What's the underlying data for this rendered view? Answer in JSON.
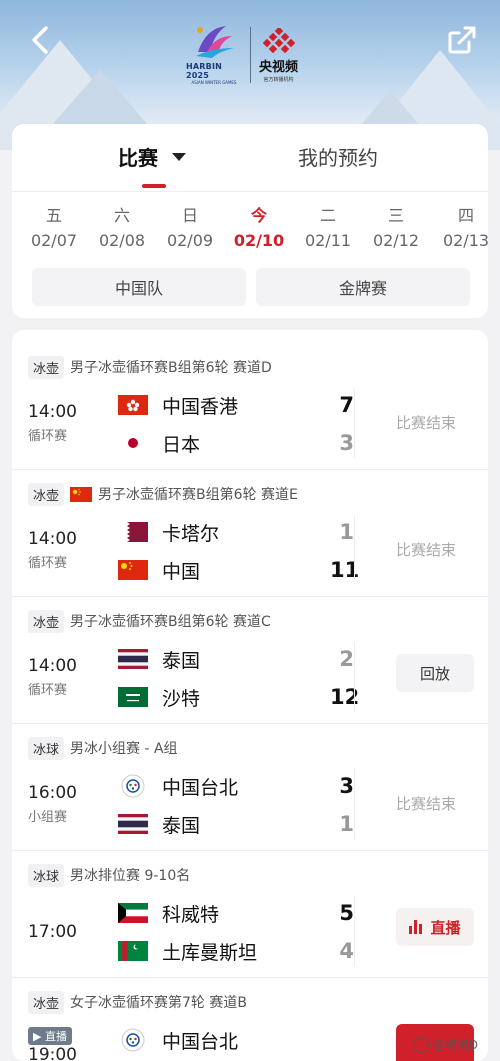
{
  "header": {
    "harbin_logo_text": "HARBIN 2025",
    "harbin_logo_sub": "ASIAN WINTER GAMES",
    "cctv_name": "央视频",
    "cctv_sub": "官方转播机构"
  },
  "main_tabs": [
    {
      "label": "比赛",
      "active": true
    },
    {
      "label": "我的预约",
      "active": false
    }
  ],
  "dates": [
    {
      "weekday": "五",
      "date": "02/07"
    },
    {
      "weekday": "六",
      "date": "02/08"
    },
    {
      "weekday": "日",
      "date": "02/09"
    },
    {
      "weekday": "今",
      "date": "02/10",
      "active": true
    },
    {
      "weekday": "二",
      "date": "02/11"
    },
    {
      "weekday": "三",
      "date": "02/12"
    },
    {
      "weekday": "四",
      "date": "02/13"
    }
  ],
  "filters": [
    "中国队",
    "金牌赛"
  ],
  "matches": [
    {
      "sport": "冰壶",
      "event": "男子冰壶循环赛B组第6轮 赛道D",
      "time": "14:00",
      "stage": "循环赛",
      "team1": {
        "name": "中国香港",
        "score": "7",
        "flag": "hk-flag-icon"
      },
      "team2": {
        "name": "日本",
        "score": "3",
        "flag": "japan-flag-icon"
      },
      "status": "比赛结束"
    },
    {
      "sport": "冰壶",
      "event": "男子冰壶循环赛B组第6轮 赛道E",
      "time": "14:00",
      "stage": "循环赛",
      "team1": {
        "name": "卡塔尔",
        "score": "1",
        "flag": "qatar-flag-icon"
      },
      "team2": {
        "name": "中国",
        "score": "11",
        "flag": "china-flag-icon"
      },
      "status": "比赛结束"
    },
    {
      "sport": "冰壶",
      "event": "男子冰壶循环赛B组第6轮 赛道C",
      "time": "14:00",
      "stage": "循环赛",
      "team1": {
        "name": "泰国",
        "score": "2",
        "flag": "thailand-flag-icon"
      },
      "team2": {
        "name": "沙特",
        "score": "12",
        "flag": "saudi-flag-icon"
      },
      "status": "回放"
    },
    {
      "sport": "冰球",
      "event": "男冰小组赛 - A组",
      "time": "16:00",
      "stage": "小组赛",
      "team1": {
        "name": "中国台北",
        "score": "3",
        "flag": "chinese-taipei-flag-icon"
      },
      "team2": {
        "name": "泰国",
        "score": "1",
        "flag": "thailand-flag-icon"
      },
      "status": "比赛结束"
    },
    {
      "sport": "冰球",
      "event": "男冰排位赛 9-10名",
      "time": "17:00",
      "stage": "",
      "team1": {
        "name": "科威特",
        "score": "5",
        "flag": "kuwait-flag-icon"
      },
      "team2": {
        "name": "土库曼斯坦",
        "score": "4",
        "flag": "turkmenistan-flag-icon"
      },
      "status": "直播"
    },
    {
      "sport": "冰壶",
      "event": "女子冰壶循环赛第7轮 赛道B",
      "time": "19:00",
      "stage": "",
      "live_tag": "直播",
      "team1": {
        "name": "中国台北",
        "score": "",
        "flag": "chinese-taipei-flag-icon"
      }
    }
  ],
  "watermark": "@猪猪D"
}
